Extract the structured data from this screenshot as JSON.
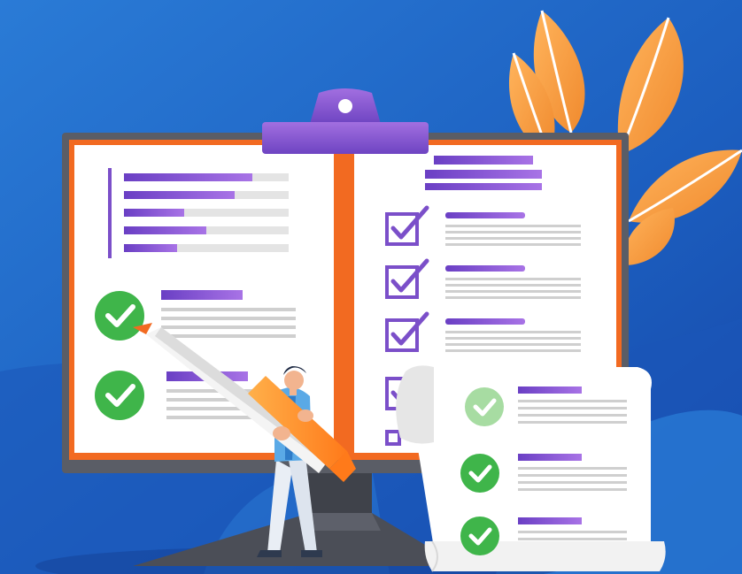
{
  "illustration": {
    "subject": "checklist-on-monitor",
    "colors": {
      "background": "#1f62c4",
      "background_light": "#2a7bd6",
      "monitor_frame": "#5a5d66",
      "paper": "#ffffff",
      "paper_border": "#f26a21",
      "purple": "#7b4fc9",
      "purple_light": "#a26fe0",
      "check_green": "#3fb54a",
      "leaf_orange": "#f7a24c",
      "skin": "#f2b48f",
      "shirt": "#5aa9e6"
    },
    "icons": {
      "left_checks": [
        "check-circle-icon",
        "check-circle-icon"
      ],
      "right_checkboxes": [
        "checkbox-checked-icon",
        "checkbox-checked-icon",
        "checkbox-checked-icon",
        "checkbox-checked-icon"
      ],
      "scroll_checks": [
        "check-circle-icon",
        "check-circle-icon",
        "check-circle-icon"
      ]
    }
  }
}
